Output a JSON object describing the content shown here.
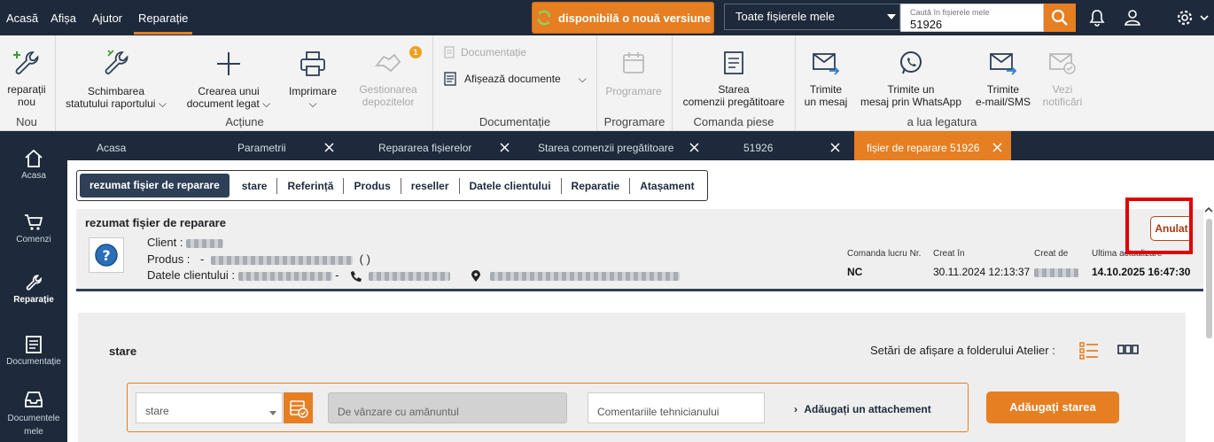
{
  "topbar": {
    "menu": [
      "Acasă",
      "Afișa",
      "Ajutor",
      "Reparație"
    ],
    "update_label": "disponibilă o nouă versiune",
    "filter_label": "Toate fișierele mele",
    "search_placeholder": "Caută în fișierele mele",
    "search_value": "51926"
  },
  "ribbon": {
    "nou": {
      "new_repair": "reparații nou",
      "group": "Nou"
    },
    "actiune": {
      "change_status_l1": "Schimbarea",
      "change_status_l2": "statutului raportului",
      "create_doc_l1": "Crearea unui",
      "create_doc_l2": "document legat",
      "print": "Imprimare",
      "manage_l1": "Gestionarea",
      "manage_l2": "depozitelor",
      "manage_badge": "1",
      "group": "Acțiune"
    },
    "documentatie": {
      "doc_link": "Documentație",
      "show_docs": "Afișează documente",
      "group": "Documentație"
    },
    "programare": {
      "schedule": "Programare",
      "group": "Programare"
    },
    "comanda": {
      "order_l1": "Starea",
      "order_l2": "comenzii pregătitoare",
      "group": "Comanda piese"
    },
    "legatura": {
      "send_msg_l1": "Trimite",
      "send_msg_l2": "un mesaj",
      "whatsapp_l1": "Trimite un",
      "whatsapp_l2": "mesaj prin WhatsApp",
      "email_l1": "Trimite",
      "email_l2": "e-mail/SMS",
      "notif_l1": "Vezi",
      "notif_l2": "notificări",
      "group": "a lua legatura"
    }
  },
  "sidebar": {
    "items": [
      "Acasa",
      "Comenzi",
      "Reparație",
      "Documentație",
      "Documentele mele"
    ]
  },
  "tabs": [
    "Acasa",
    "Parametrii",
    "Repararea fișierelor",
    "Starea comenzii pregătitoare",
    "51926",
    "fișier de reparare 51926"
  ],
  "subtabs": [
    "rezumat fișier de reparare",
    "stare",
    "Referință",
    "Produs",
    "reseller",
    "Datele clientului",
    "Reparatie",
    "Atașament"
  ],
  "summary": {
    "title": "rezumat fișier de reparare",
    "client_label": "Client :",
    "product_label": "Produs :",
    "product_sep": "-",
    "product_paren": "( )",
    "client_data_label": "Datele clientului :",
    "client_data_sep": "-",
    "status_badge": "Anulat",
    "meta": [
      {
        "label": "Comanda lucru Nr.",
        "value": "NC"
      },
      {
        "label": "Creat în",
        "value": "30.11.2024 12:13:37"
      },
      {
        "label": "Creat de",
        "value": ""
      },
      {
        "label": "Ultima actualizare",
        "value": "14.10.2025 16:47:30"
      }
    ]
  },
  "stare": {
    "title": "stare",
    "settings_label": "Setări de afișare a folderului Atelier :",
    "select_value": "stare",
    "sale_placeholder": "De vânzare cu amănuntul",
    "comment_placeholder": "Comentariile tehnicianului",
    "attach_label": "Adăugați un attachement",
    "add_button": "Adăugați starea"
  },
  "colors": {
    "navy": "#1e2a3b",
    "accent": "#e67e22",
    "cancelled": "#b5441a"
  }
}
